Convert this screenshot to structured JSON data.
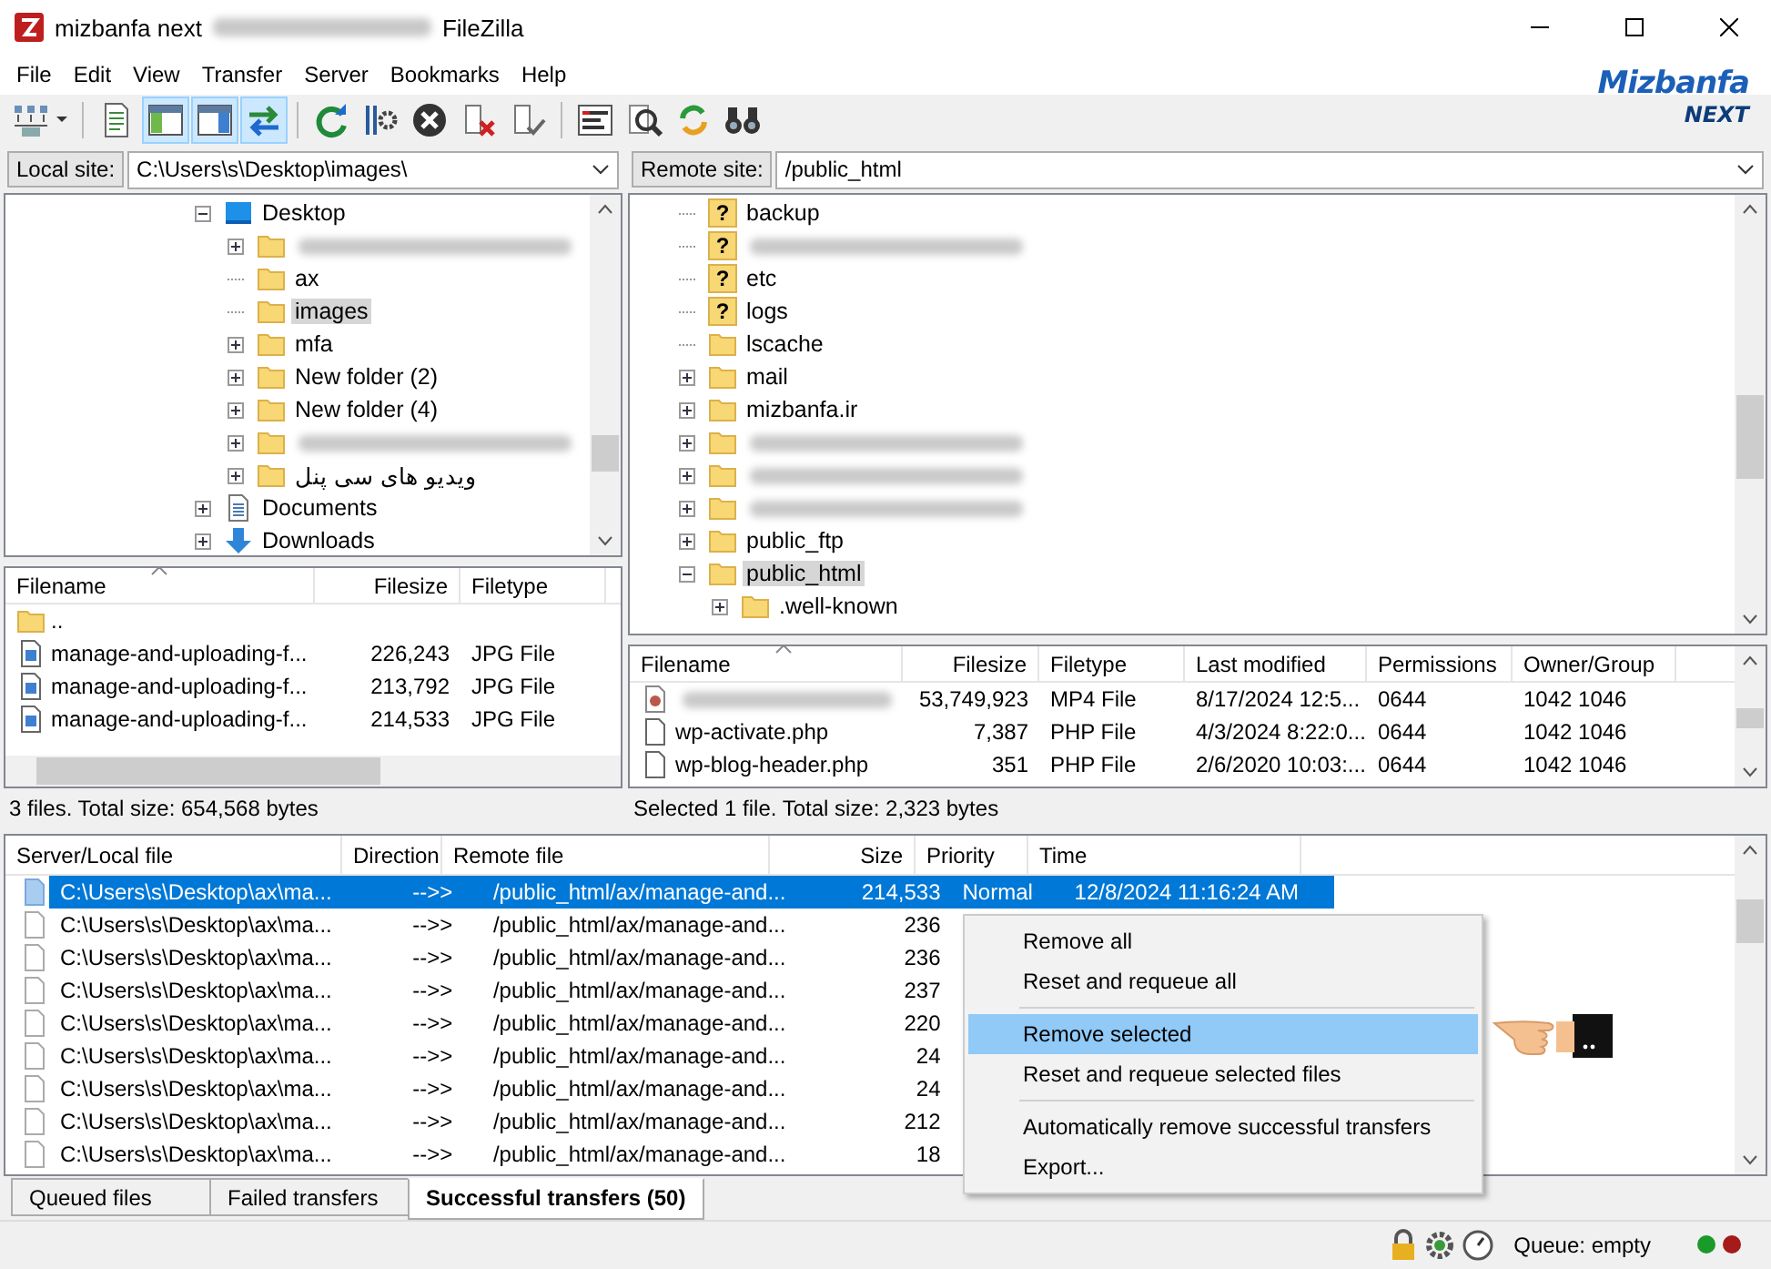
{
  "window": {
    "title_site": "mizbanfa next",
    "title_app": "FileZilla"
  },
  "menu": [
    "File",
    "Edit",
    "View",
    "Transfer",
    "Server",
    "Bookmarks",
    "Help"
  ],
  "logo": {
    "name": "Mizbanfa",
    "tagline": "NEXT"
  },
  "toolbar": [
    {
      "kind": "sitemanager",
      "selected": false
    },
    {
      "kind": "log",
      "selected": false
    },
    {
      "kind": "localtree",
      "selected": true
    },
    {
      "kind": "remotetree",
      "selected": true
    },
    {
      "kind": "queue",
      "selected": true
    },
    {
      "kind": "refresh",
      "selected": false
    },
    {
      "kind": "process",
      "selected": false
    },
    {
      "kind": "cancel",
      "selected": false
    },
    {
      "kind": "disconnect",
      "selected": false
    },
    {
      "kind": "reconnect",
      "selected": false
    },
    {
      "kind": "filter",
      "selected": false
    },
    {
      "kind": "compare",
      "selected": false
    },
    {
      "kind": "sync",
      "selected": false
    },
    {
      "kind": "search",
      "selected": false
    }
  ],
  "local": {
    "label": "Local site:",
    "path": "C:\\Users\\s\\Desktop\\images\\",
    "tree": [
      {
        "name": "Desktop",
        "kind": "desktop",
        "expanded": true,
        "selected": false,
        "children": [
          {
            "kind": "folder",
            "expanded": false,
            "selected": false
          },
          {
            "name": "ax",
            "kind": "folder",
            "selected": false
          },
          {
            "name": "images",
            "kind": "folder",
            "selected": true
          },
          {
            "name": "mfa",
            "kind": "folder",
            "expanded": false,
            "selected": false
          },
          {
            "name": "New folder (2)",
            "kind": "folder",
            "expanded": false,
            "selected": false
          },
          {
            "name": "New folder (4)",
            "kind": "folder",
            "expanded": false,
            "selected": false
          },
          {
            "kind": "folder",
            "expanded": false,
            "selected": false
          },
          {
            "name": "ویدیو های سی پنل",
            "kind": "folder",
            "expanded": false,
            "selected": false
          }
        ]
      },
      {
        "name": "Documents",
        "kind": "documents",
        "expanded": false,
        "selected": false
      },
      {
        "name": "Downloads",
        "kind": "downloads",
        "expanded": false,
        "selected": false
      }
    ],
    "columns": [
      "Filename",
      "Filesize",
      "Filetype"
    ],
    "files": [
      {
        "kind": "folder",
        "cells": [
          ".."
        ]
      },
      {
        "kind": "image",
        "cells": [
          "manage-and-uploading-f...",
          "226,243",
          "JPG File"
        ]
      },
      {
        "kind": "image",
        "cells": [
          "manage-and-uploading-f...",
          "213,792",
          "JPG File"
        ]
      },
      {
        "kind": "image",
        "cells": [
          "manage-and-uploading-f...",
          "214,533",
          "JPG File"
        ]
      }
    ],
    "status": "3 files. Total size: 654,568 bytes"
  },
  "remote": {
    "label": "Remote site:",
    "path": "/public_html",
    "tree": [
      {
        "name": "backup",
        "kind": "unknown",
        "badge": "?",
        "selected": false
      },
      {
        "kind": "unknown",
        "badge": "?",
        "selected": false
      },
      {
        "name": "etc",
        "kind": "unknown",
        "badge": "?",
        "selected": false
      },
      {
        "name": "logs",
        "kind": "unknown",
        "badge": "?",
        "selected": false
      },
      {
        "name": "lscache",
        "kind": "folder",
        "selected": false
      },
      {
        "name": "mail",
        "kind": "folder",
        "expanded": false,
        "selected": false
      },
      {
        "name": "mizbanfa.ir",
        "kind": "folder",
        "expanded": false,
        "selected": false
      },
      {
        "kind": "folder",
        "expanded": false,
        "selected": false
      },
      {
        "kind": "folder",
        "expanded": false,
        "selected": false
      },
      {
        "kind": "folder",
        "expanded": false,
        "selected": false
      },
      {
        "name": "public_ftp",
        "kind": "folder",
        "expanded": false,
        "selected": false
      },
      {
        "name": "public_html",
        "kind": "folder",
        "expanded": true,
        "selected": true,
        "children": [
          {
            "name": ".well-known",
            "kind": "folder",
            "expanded": false,
            "selected": false
          }
        ]
      }
    ],
    "columns": [
      "Filename",
      "Filesize",
      "Filetype",
      "Last modified",
      "Permissions",
      "Owner/Group"
    ],
    "files": [
      {
        "kind": "video",
        "cells": [
          null,
          "53,749,923",
          "MP4 File",
          "8/17/2024 12:5...",
          "0644",
          "1042 1046"
        ]
      },
      {
        "kind": "php",
        "cells": [
          "wp-activate.php",
          "7,387",
          "PHP File",
          "4/3/2024 8:22:0...",
          "0644",
          "1042 1046"
        ]
      },
      {
        "kind": "php",
        "cells": [
          "wp-blog-header.php",
          "351",
          "PHP File",
          "2/6/2020 10:03:...",
          "0644",
          "1042 1046"
        ]
      }
    ],
    "status": "Selected 1 file. Total size: 2,323 bytes"
  },
  "queue": {
    "columns": [
      "Server/Local file",
      "Direction",
      "Remote file",
      "Size",
      "Priority",
      "Time"
    ],
    "rows": [
      {
        "selected": true,
        "cells": [
          "C:\\Users\\s\\Desktop\\ax\\ma...",
          "-->>",
          "/public_html/ax/manage-and...",
          "214,533",
          "Normal",
          "12/8/2024 11:16:24 AM"
        ]
      },
      {
        "selected": false,
        "cells": [
          "C:\\Users\\s\\Desktop\\ax\\ma...",
          "-->>",
          "/public_html/ax/manage-and...",
          "236"
        ]
      },
      {
        "selected": false,
        "cells": [
          "C:\\Users\\s\\Desktop\\ax\\ma...",
          "-->>",
          "/public_html/ax/manage-and...",
          "236"
        ]
      },
      {
        "selected": false,
        "cells": [
          "C:\\Users\\s\\Desktop\\ax\\ma...",
          "-->>",
          "/public_html/ax/manage-and...",
          "237"
        ]
      },
      {
        "selected": false,
        "cells": [
          "C:\\Users\\s\\Desktop\\ax\\ma...",
          "-->>",
          "/public_html/ax/manage-and...",
          "220"
        ]
      },
      {
        "selected": false,
        "cells": [
          "C:\\Users\\s\\Desktop\\ax\\ma...",
          "-->>",
          "/public_html/ax/manage-and...",
          "24"
        ]
      },
      {
        "selected": false,
        "cells": [
          "C:\\Users\\s\\Desktop\\ax\\ma...",
          "-->>",
          "/public_html/ax/manage-and...",
          "24"
        ]
      },
      {
        "selected": false,
        "cells": [
          "C:\\Users\\s\\Desktop\\ax\\ma...",
          "-->>",
          "/public_html/ax/manage-and...",
          "212"
        ]
      },
      {
        "selected": false,
        "cells": [
          "C:\\Users\\s\\Desktop\\ax\\ma...",
          "-->>",
          "/public_html/ax/manage-and...",
          "18"
        ]
      }
    ],
    "menu": [
      {
        "kind": "item",
        "label": "Remove all",
        "selected": false
      },
      {
        "kind": "item",
        "label": "Reset and requeue all",
        "selected": false
      },
      {
        "kind": "separator"
      },
      {
        "kind": "item",
        "label": "Remove selected",
        "selected": true
      },
      {
        "kind": "item",
        "label": "Reset and requeue selected files",
        "selected": false
      },
      {
        "kind": "separator"
      },
      {
        "kind": "item",
        "label": "Automatically remove successful transfers",
        "selected": false
      },
      {
        "kind": "item",
        "label": "Export...",
        "selected": false
      }
    ]
  },
  "tabs": [
    {
      "label": "Queued files",
      "selected": false
    },
    {
      "label": "Failed transfers",
      "selected": false
    },
    {
      "label": "Successful transfers (50)",
      "selected": true
    }
  ],
  "status_bar": {
    "queue": "Queue: empty"
  }
}
